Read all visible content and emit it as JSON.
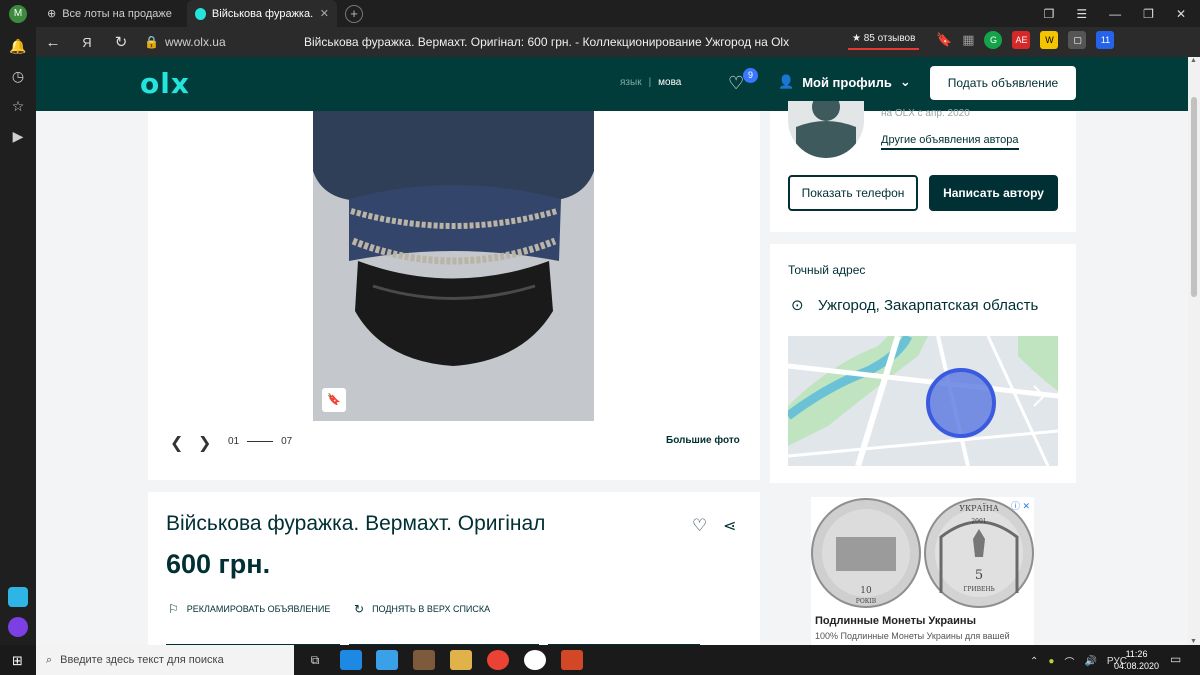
{
  "browser": {
    "profile_letter": "М",
    "tabs": [
      {
        "title": "Все лоты на продаже пол",
        "active": false
      },
      {
        "title": "Військова фуражка. Вер",
        "active": true
      }
    ],
    "url": "www.olx.ua",
    "page_title": "Військова фуражка. Вермахт. Оригінал: 600 грн. - Коллекционирование Ужгород на Olx",
    "reviews_badge": "★ 85 отзывов",
    "extensions": [
      {
        "name": "grammarly",
        "label": "G",
        "color": "#15a34a"
      },
      {
        "name": "ae-extension",
        "label": "AE",
        "color": "#d62828"
      },
      {
        "name": "w-extension",
        "label": "W",
        "color": "#f4c400"
      },
      {
        "name": "download-extension",
        "label": "11",
        "color": "#2563eb"
      }
    ]
  },
  "header": {
    "logo": "olx",
    "lang_ru": "язык",
    "lang_sep": "|",
    "lang_ua": "мова",
    "favorites_count": "9",
    "profile_label": "Мой профиль",
    "post_ad_label": "Подать объявление"
  },
  "gallery": {
    "current": "01",
    "total": "07",
    "bigger_photo": "Большие фото"
  },
  "listing": {
    "title": "Військова фуражка. Вермахт. Оригінал",
    "price": "600 грн.",
    "promote": "РЕКЛАМИРОВАТЬ ОБЪЯВЛЕНИЕ",
    "raise": "ПОДНЯТЬ В ВЕРХ СПИСКА"
  },
  "seller": {
    "since": "на OLX с апр. 2020",
    "other_ads": "Другие объявления автора",
    "show_phone": "Показать телефон",
    "write": "Написать автору"
  },
  "address": {
    "heading": "Точный адрес",
    "location": "Ужгород, Закарпатская область"
  },
  "ad": {
    "title": "Подлинные Монеты Украины",
    "subtitle": "100% Подлинные Монеты Украины для вашей",
    "coin_left_value": "10",
    "coin_left_unit": "РОКІВ",
    "coin_right_country": "УКРАЇНА",
    "coin_right_year": "2001",
    "coin_right_value": "5",
    "coin_right_unit": "ГРИВЕНЬ"
  },
  "taskbar": {
    "search_placeholder": "Введите здесь текст для поиска",
    "lang": "РУС",
    "time": "11:26",
    "date": "04.08.2020"
  }
}
